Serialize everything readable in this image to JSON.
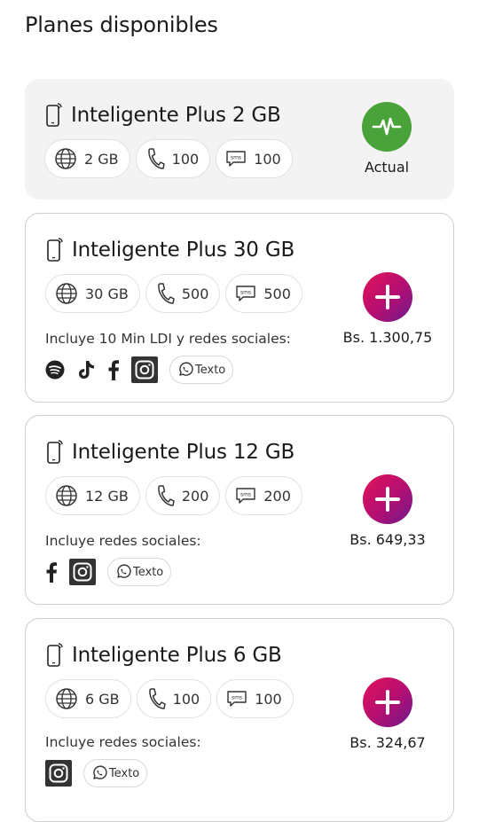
{
  "page_title": "Planes disponibles",
  "plans": [
    {
      "name": "Inteligente Plus 2 GB",
      "data": "2 GB",
      "minutes": "100",
      "sms": "100",
      "status_label": "Actual"
    },
    {
      "name": "Inteligente Plus 30 GB",
      "data": "30 GB",
      "minutes": "500",
      "sms": "500",
      "includes": "Incluye 10 Min LDI y redes sociales:",
      "social": [
        "spotify",
        "tiktok",
        "facebook",
        "instagram",
        "whatsapp"
      ],
      "whatsapp_label": "Texto",
      "price": "Bs. 1.300,75"
    },
    {
      "name": "Inteligente Plus 12 GB",
      "data": "12 GB",
      "minutes": "200",
      "sms": "200",
      "includes": "Incluye redes sociales:",
      "social": [
        "facebook",
        "instagram",
        "whatsapp"
      ],
      "whatsapp_label": "Texto",
      "price": "Bs. 649,33"
    },
    {
      "name": "Inteligente Plus 6 GB",
      "data": "6 GB",
      "minutes": "100",
      "sms": "100",
      "includes": "Incluye redes sociales:",
      "social": [
        "instagram",
        "whatsapp"
      ],
      "whatsapp_label": "Texto",
      "price": "Bs. 324,67"
    }
  ],
  "sms_icon_text": "sms",
  "colors": {
    "current_bg": "#f3f3f3",
    "current_badge": "#4aa33a",
    "plus_gradient": [
      "#e3135a",
      "#b20f72",
      "#6b1a8e"
    ],
    "card_border": "#cfcfcf"
  }
}
